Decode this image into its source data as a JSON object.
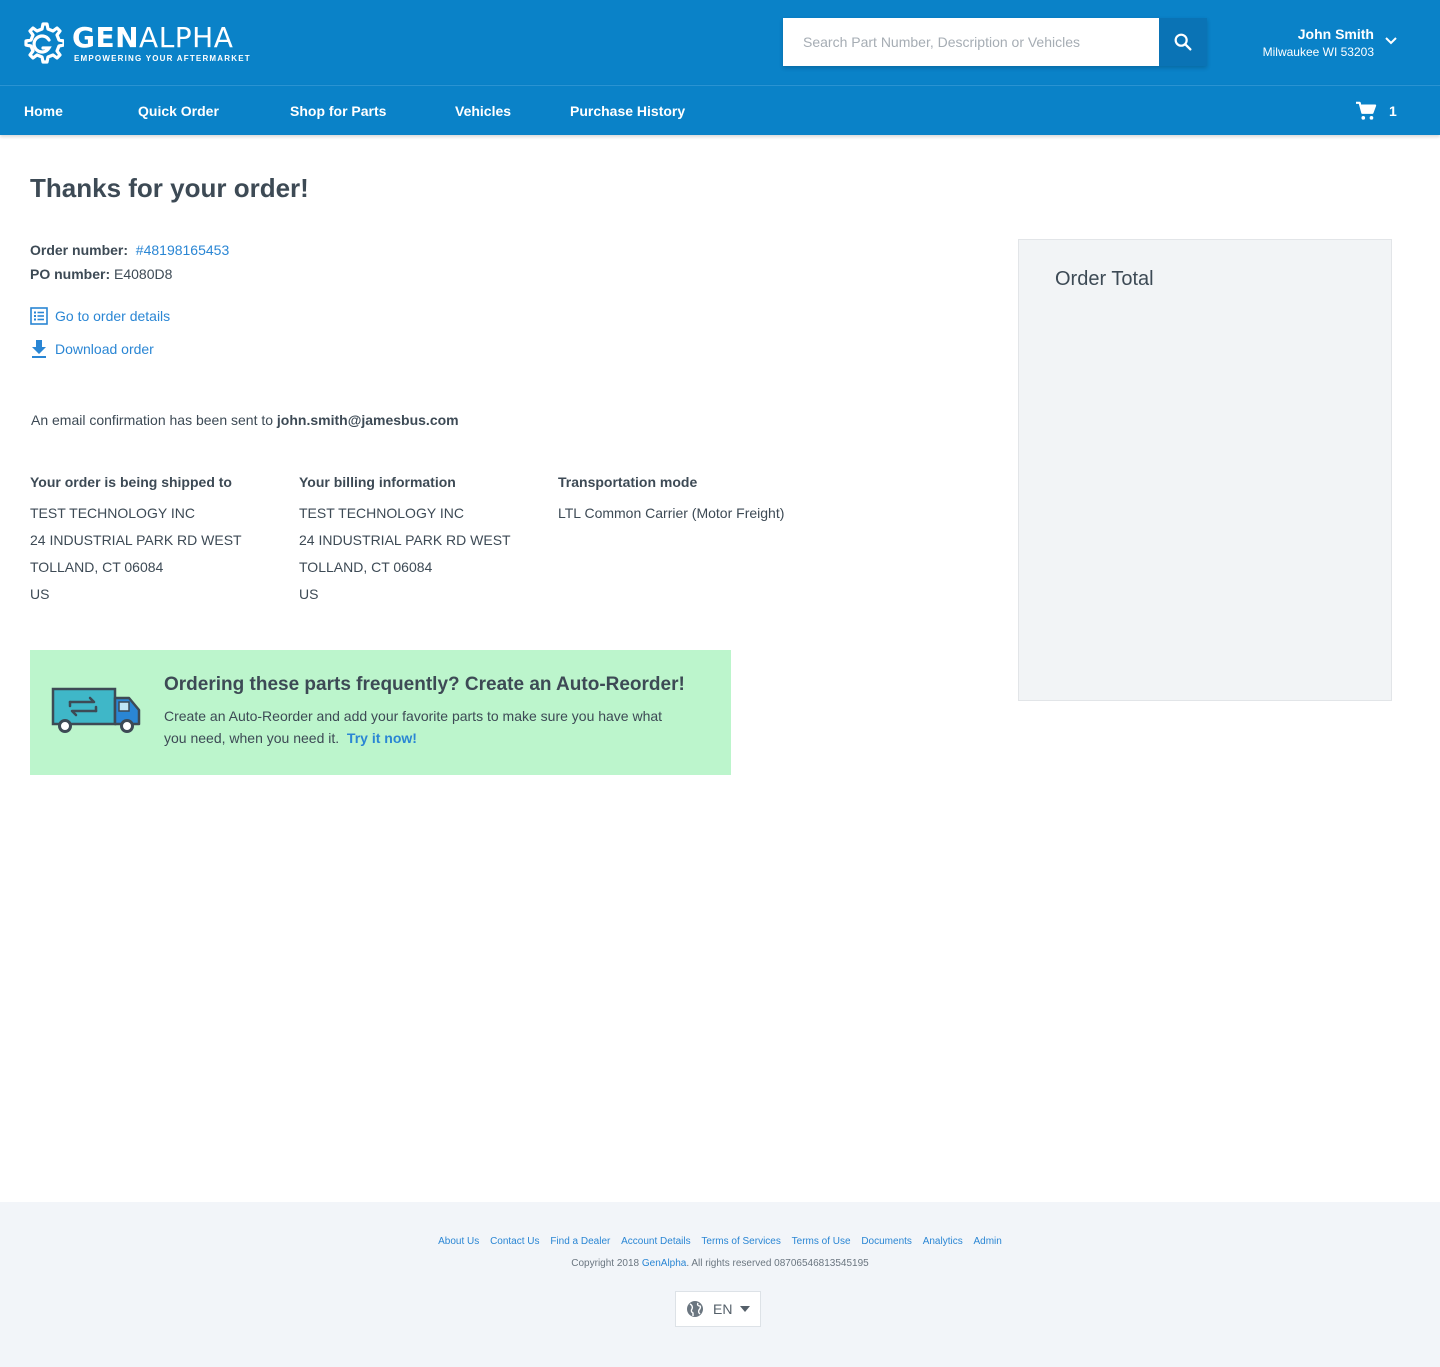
{
  "header": {
    "logo_name_bold": "GEN",
    "logo_name_light": "ALPHA",
    "logo_tagline": "EMPOWERING YOUR AFTERMARKET",
    "search_placeholder": "Search Part Number, Description or Vehicles",
    "search_icon": "search-icon",
    "user_name": "John Smith",
    "user_location": "Milwaukee WI 53203",
    "brand_color": "#0a82c8"
  },
  "nav": {
    "items": [
      "Home",
      "Quick Order",
      "Shop for Parts",
      "Vehicles",
      "Purchase History"
    ],
    "cart_count": "1",
    "cart_icon": "cart-icon"
  },
  "main": {
    "title": "Thanks for your order!",
    "order_number_label": "Order number:",
    "order_number": "#48198165453",
    "po_number_label": "PO number:",
    "po_number": "E4080D8",
    "order_details_link": "Go to order details",
    "download_link": "Download order",
    "email_prefix": "An email confirmation has been sent to",
    "email": "john.smith@jamesbus.com",
    "shipping": {
      "heading": "Your order is being shipped to",
      "lines": [
        "TEST TECHNOLOGY INC",
        "24 INDUSTRIAL PARK RD WEST",
        "TOLLAND, CT 06084",
        "US"
      ]
    },
    "billing": {
      "heading": "Your billing information",
      "lines": [
        "TEST TECHNOLOGY INC",
        "24 INDUSTRIAL PARK RD WEST",
        "TOLLAND, CT 06084",
        "US"
      ]
    },
    "transport": {
      "heading": "Transportation mode",
      "value": "LTL Common Carrier (Motor Freight)"
    },
    "promo": {
      "title": "Ordering these parts frequently?  Create an Auto-Reorder!",
      "text": "Create an Auto-Reorder and add your favorite parts to make sure you have what you need, when you need it.",
      "cta": "Try it now!",
      "background": "#bcf5cc"
    },
    "order_total_heading": "Order Total"
  },
  "footer": {
    "links": [
      "About Us",
      "Contact Us",
      "Find a Dealer",
      "Account Details",
      "Terms of Services",
      "Terms of Use",
      "Documents",
      "Analytics",
      "Admin"
    ],
    "copyright_prefix": "Copyright 2018",
    "copyright_brand": "GenAlpha",
    "copyright_suffix": ". All rights reserved 08706546813545195",
    "language": "EN"
  }
}
